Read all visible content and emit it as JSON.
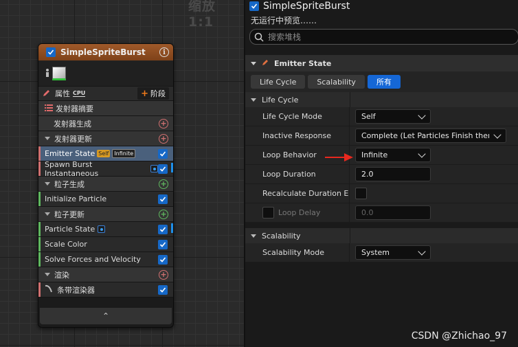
{
  "graph": {
    "zoom_label": "缩放 1:1",
    "node": {
      "title": "SimpleSpriteBurst",
      "info_glyph": "i",
      "tool_row": {
        "properties_label": "属性",
        "cpu_label": "CPU",
        "stage_label": "阶段",
        "stage_plus": "+"
      },
      "rows": [
        {
          "label": "发射器摘要"
        },
        {
          "label": "发射器生成"
        },
        {
          "label": "发射器更新"
        },
        {
          "label": "Emitter State",
          "badge1": "Self",
          "badge2": "Infinite"
        },
        {
          "label": "Spawn Burst Instantaneous"
        },
        {
          "label": "粒子生成"
        },
        {
          "label": "Initialize Particle"
        },
        {
          "label": "粒子更新"
        },
        {
          "label": "Particle State"
        },
        {
          "label": "Scale Color"
        },
        {
          "label": "Solve Forces and Velocity"
        },
        {
          "label": "渲染"
        },
        {
          "label": "条带渲染器"
        }
      ],
      "footer_glyph": "⌃"
    }
  },
  "details": {
    "title": "SimpleSpriteBurst",
    "preview_text": "无运行中预览……",
    "search_placeholder": "搜索堆栈",
    "category": "Emitter State",
    "filters": [
      "Life Cycle",
      "Scalability",
      "所有"
    ],
    "sections": {
      "life_cycle": "Life Cycle",
      "scalability": "Scalability"
    },
    "props": {
      "life_cycle_mode": {
        "name": "Life Cycle Mode",
        "value": "Self"
      },
      "inactive_response": {
        "name": "Inactive Response",
        "value": "Complete (Let Particles Finish then"
      },
      "loop_behavior": {
        "name": "Loop Behavior",
        "value": "Infinite"
      },
      "loop_duration": {
        "name": "Loop Duration",
        "value": "2.0"
      },
      "recalculate": {
        "name": "Recalculate Duration Eac"
      },
      "loop_delay": {
        "name": "Loop Delay",
        "value": "0.0"
      },
      "scalability_mode": {
        "name": "Scalability Mode",
        "value": "System"
      }
    }
  },
  "watermark": "CSDN @Zhichao_97",
  "colors": {
    "accent_blue": "#1567d6",
    "node_header": "#a05a2a",
    "highlight_row": "#4a607c",
    "arrow_red": "#e8281e"
  }
}
